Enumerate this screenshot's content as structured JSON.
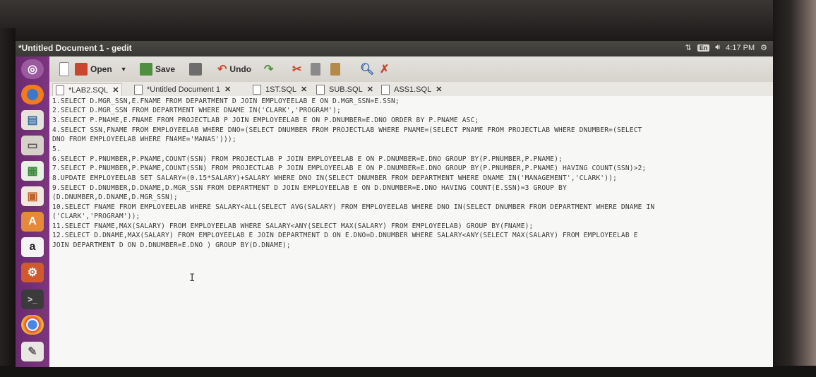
{
  "window": {
    "title": "*Untitled Document 1 - gedit"
  },
  "panel": {
    "keyboard": "En",
    "time": "4:17 PM"
  },
  "toolbar": {
    "open_label": "Open",
    "save_label": "Save",
    "undo_label": "Undo"
  },
  "tabs": [
    {
      "label": "*LAB2.SQL"
    },
    {
      "label": "*Untitled Document 1"
    },
    {
      "label": "1ST.SQL"
    },
    {
      "label": "SUB.SQL"
    },
    {
      "label": "ASS1.SQL"
    }
  ],
  "launcher": [
    "ubuntu-dash",
    "firefox",
    "files",
    "document-viewer",
    "libreoffice-calc",
    "libreoffice-impress",
    "software-center",
    "amazon",
    "system-settings",
    "terminal",
    "chrome",
    "text-editor"
  ],
  "editor": {
    "lines": [
      "1.SELECT D.MGR_SSN,E.FNAME FROM DEPARTMENT D JOIN EMPLOYEELAB E ON D.MGR_SSN=E.SSN;",
      "2.SELECT D.MGR_SSN FROM DEPARTMENT WHERE DNAME IN('CLARK','PROGRAM');",
      "3.SELECT P.PNAME,E.FNAME FROM PROJECTLAB P JOIN EMPLOYEELAB E ON P.DNUMBER=E.DNO ORDER BY P.PNAME ASC;",
      "4.SELECT SSN,FNAME FROM EMPLOYEELAB WHERE DNO=(SELECT DNUMBER FROM PROJECTLAB WHERE PNAME=(SELECT PNAME FROM PROJECTLAB WHERE DNUMBER=(SELECT",
      "DNO FROM EMPLOYEELAB WHERE FNAME='MANAS')));",
      "5.",
      "6.SELECT P.PNUMBER,P.PNAME,COUNT(SSN) FROM PROJECTLAB P JOIN EMPLOYEELAB E ON P.DNUMBER=E.DNO GROUP BY(P.PNUMBER,P.PNAME);",
      "7.SELECT P.PNUMBER,P.PNAME,COUNT(SSN) FROM PROJECTLAB P JOIN EMPLOYEELAB E ON P.DNUMBER=E.DNO GROUP BY(P.PNUMBER,P.PNAME) HAVING COUNT(SSN)>2;",
      "8.UPDATE EMPLOYEELAB SET SALARY=(0.15*SALARY)+SALARY WHERE DNO IN(SELECT DNUMBER FROM DEPARTMENT WHERE DNAME IN('MANAGEMENT','CLARK'));",
      "9.SELECT D.DNUMBER,D.DNAME,D.MGR_SSN FROM DEPARTMENT D JOIN EMPLOYEELAB E ON D.DNUMBER=E.DNO HAVING COUNT(E.SSN)=3 GROUP BY",
      "(D.DNUMBER,D.DNAME,D.MGR_SSN);",
      "10.SELECT FNAME FROM EMPLOYEELAB WHERE SALARY<ALL(SELECT AVG(SALARY) FROM EMPLOYEELAB WHERE DNO IN(SELECT DNUMBER FROM DEPARTMENT WHERE DNAME IN",
      "('CLARK','PROGRAM'));",
      "11.SELECT FNAME,MAX(SALARY) FROM EMPLOYEELAB WHERE SALARY<ANY(SELECT MAX(SALARY) FROM EMPLOYEELAB) GROUP BY(FNAME);",
      "12.SELECT D.DNAME,MAX(SALARY) FROM EMPLOYEELAB E JOIN DEPARTMENT D ON E.DNO=D.DNUMBER WHERE SALARY<ANY(SELECT MAX(SALARY) FROM EMPLOYEELAB E",
      "JOIN DEPARTMENT D ON D.DNUMBER=E.DNO ) GROUP BY(D.DNAME);"
    ]
  }
}
